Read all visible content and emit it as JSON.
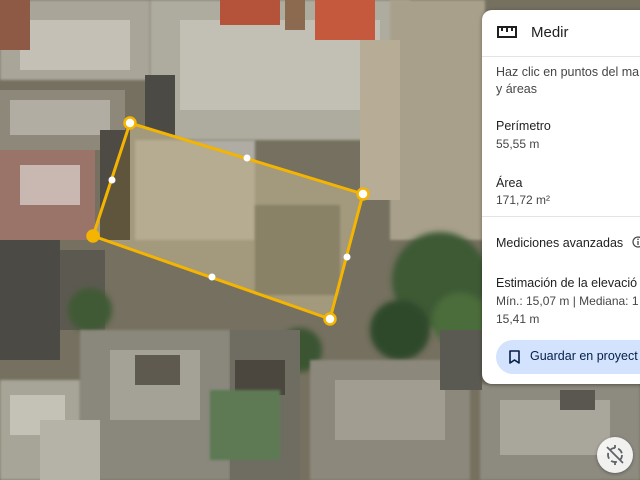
{
  "panel": {
    "title": "Medir",
    "title_icon": "ruler-icon",
    "instruction_line1": "Haz clic en puntos del ma",
    "instruction_line2": "y áreas",
    "perimeter_label": "Perímetro",
    "perimeter_value": "55,55 m",
    "area_label": "Área",
    "area_value": "171,72 m²",
    "advanced_label": "Mediciones avanzadas",
    "advanced_icon": "info-icon",
    "elevation_label": "Estimación de la elevació",
    "elevation_line1": "Mín.: 15,07 m | Mediana: 1",
    "elevation_line2": "15,41 m",
    "save_label": "Guardar en proyect",
    "save_icon": "bookmark-icon"
  },
  "map": {
    "polygon_color": "#f4b400",
    "compass_icon": "compass-off-icon"
  }
}
